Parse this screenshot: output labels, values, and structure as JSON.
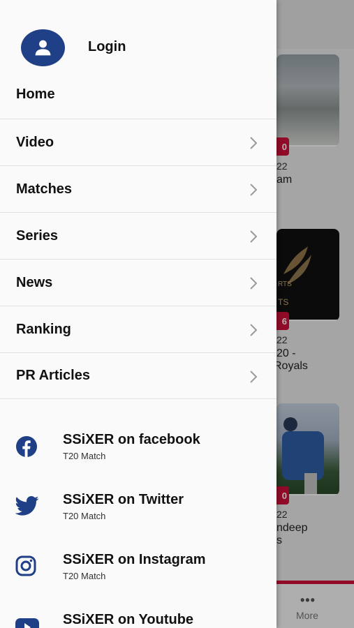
{
  "drawer": {
    "login_label": "Login",
    "home_label": "Home",
    "menu_items": [
      {
        "label": "Video"
      },
      {
        "label": "Matches"
      },
      {
        "label": "Series"
      },
      {
        "label": "News"
      },
      {
        "label": "Ranking"
      },
      {
        "label": "PR Articles"
      }
    ],
    "social_links": [
      {
        "title": "SSiXER on facebook",
        "subtitle": "T20 Match",
        "icon": "facebook-icon"
      },
      {
        "title": "SSiXER on Twitter",
        "subtitle": "T20 Match",
        "icon": "twitter-icon"
      },
      {
        "title": "SSiXER on Instagram",
        "subtitle": "T20 Match",
        "icon": "instagram-icon"
      },
      {
        "title": "SSiXER on Youtube",
        "subtitle": "",
        "icon": "youtube-icon"
      }
    ]
  },
  "background": {
    "cards": [
      {
        "badge": "0",
        "date_fragment": "22",
        "title_fragment": "am"
      },
      {
        "badge": "6",
        "date_fragment": "22",
        "title_fragment_1": "20 -",
        "title_fragment_2": "Royals",
        "thumb_text_1": "RTS",
        "thumb_text_2": "TS"
      },
      {
        "badge": "0",
        "date_fragment": "22",
        "title_fragment_1": "ndeep",
        "title_fragment_2": "s"
      }
    ],
    "bottom_nav": {
      "more_label": "More"
    }
  },
  "colors": {
    "accent": "#1f3f86",
    "brand_red": "#d0103a",
    "icon_color": "#1f3f86"
  }
}
